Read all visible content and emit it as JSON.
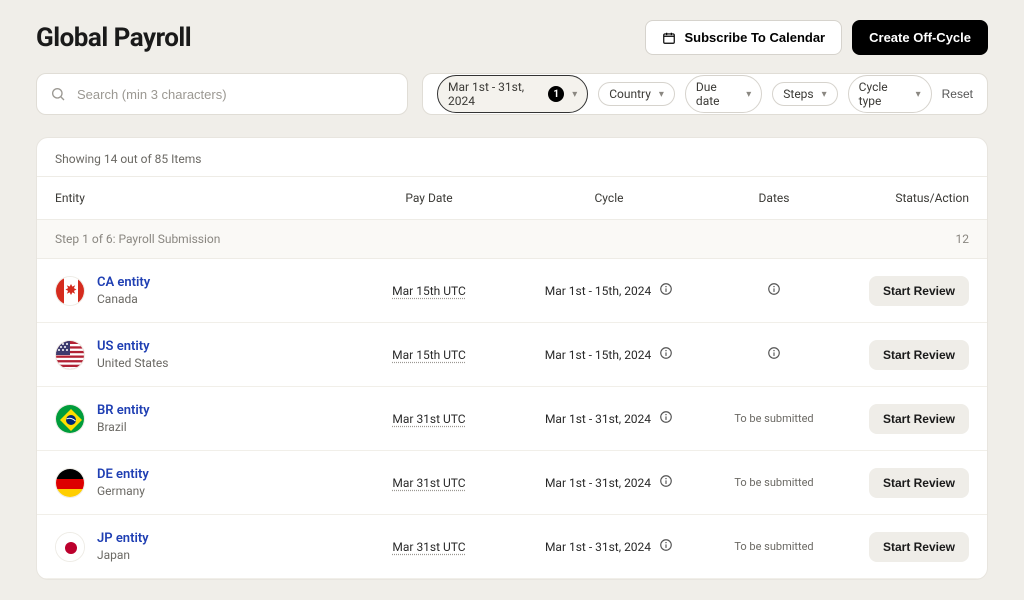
{
  "header": {
    "title": "Global Payroll",
    "subscribe_label": "Subscribe To Calendar",
    "create_label": "Create Off-Cycle"
  },
  "search": {
    "placeholder": "Search (min 3 characters)"
  },
  "filters": {
    "date_range": "Mar 1st - 31st, 2024",
    "date_count": "1",
    "country": "Country",
    "due_date": "Due date",
    "steps": "Steps",
    "cycle_type": "Cycle type",
    "reset": "Reset"
  },
  "summary": "Showing 14 out of 85 Items",
  "columns": {
    "entity": "Entity",
    "pay_date": "Pay Date",
    "cycle": "Cycle",
    "dates": "Dates",
    "status": "Status/Action"
  },
  "group": {
    "label": "Step 1 of 6: Payroll Submission",
    "count": "12"
  },
  "rows": [
    {
      "name": "CA entity",
      "country": "Canada",
      "pay_date": "Mar 15th UTC",
      "cycle": "Mar 1st - 15th, 2024",
      "dates_text": "",
      "dates_icon": true,
      "action": "Start Review",
      "flag": "ca"
    },
    {
      "name": "US entity",
      "country": "United States",
      "pay_date": "Mar 15th UTC",
      "cycle": "Mar 1st - 15th, 2024",
      "dates_text": "",
      "dates_icon": true,
      "action": "Start Review",
      "flag": "us"
    },
    {
      "name": "BR entity",
      "country": "Brazil",
      "pay_date": "Mar 31st UTC",
      "cycle": "Mar 1st - 31st, 2024",
      "dates_text": "To be submitted",
      "dates_icon": false,
      "action": "Start Review",
      "flag": "br"
    },
    {
      "name": "DE entity",
      "country": "Germany",
      "pay_date": "Mar 31st UTC",
      "cycle": "Mar 1st - 31st, 2024",
      "dates_text": "To be submitted",
      "dates_icon": false,
      "action": "Start Review",
      "flag": "de"
    },
    {
      "name": "JP entity",
      "country": "Japan",
      "pay_date": "Mar 31st UTC",
      "cycle": "Mar 1st - 31st, 2024",
      "dates_text": "To be submitted",
      "dates_icon": false,
      "action": "Start Review",
      "flag": "jp"
    }
  ]
}
